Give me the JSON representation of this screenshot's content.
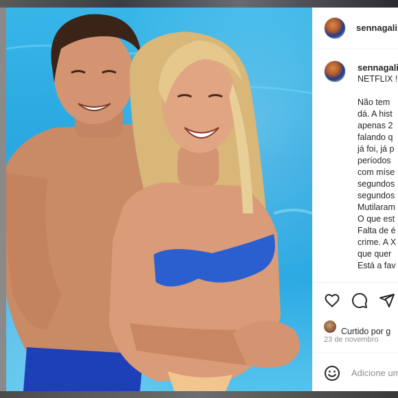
{
  "post": {
    "author": "sennagali",
    "caption_lines": [
      "NETFLIX !",
      "",
      "Não tem",
      "dá. A hist",
      "apenas 2",
      "falando q",
      "já foi, já p",
      "períodos",
      "com míse",
      "segundos",
      "segundos",
      "Mutilaram",
      "O que est",
      "Falta de é",
      "crime. A X",
      "que quer",
      "Está a fav"
    ],
    "liked_by_prefix": "Curtido por g",
    "date": "23 de novembro",
    "comment_placeholder": "Adicione um"
  },
  "icons": {
    "like": "heart-icon",
    "comment": "comment-icon",
    "share": "send-icon",
    "emoji": "emoji-icon"
  },
  "colors": {
    "pool": "#2aa9e2",
    "swimwear": "#2b5fd0",
    "text": "#262626",
    "muted": "#8e8e8e"
  }
}
